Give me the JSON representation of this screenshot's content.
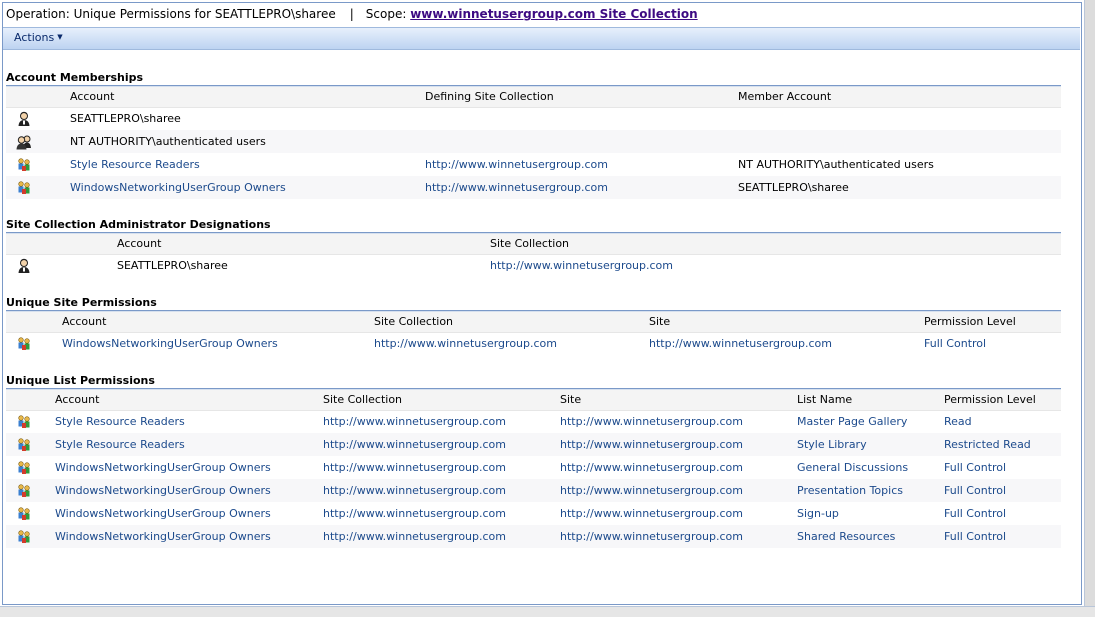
{
  "titlebar": {
    "operation": "Operation: Unique Permissions for SEATTLEPRO\\sharee",
    "separator": "|",
    "scope_label": "Scope:",
    "scope_link": "www.winnetusergroup.com Site Collection"
  },
  "toolbar": {
    "actions_label": "Actions"
  },
  "account_memberships": {
    "title": "Account Memberships",
    "headers": [
      "Account",
      "Defining Site Collection",
      "Member Account"
    ],
    "rows": [
      {
        "icon": "user-icon",
        "account": "SEATTLEPRO\\sharee",
        "site_collection": "",
        "member": ""
      },
      {
        "icon": "users-group-icon",
        "account": "NT AUTHORITY\\authenticated users",
        "site_collection": "",
        "member": ""
      },
      {
        "icon": "sharepoint-group-icon",
        "account": "Style Resource Readers",
        "site_collection": "http://www.winnetusergroup.com",
        "member": "NT AUTHORITY\\authenticated users"
      },
      {
        "icon": "sharepoint-group-icon",
        "account": "WindowsNetworkingUserGroup Owners",
        "site_collection": "http://www.winnetusergroup.com",
        "member": "SEATTLEPRO\\sharee"
      }
    ]
  },
  "admin_designations": {
    "title": "Site Collection Administrator Designations",
    "headers": [
      "Account",
      "Site Collection"
    ],
    "rows": [
      {
        "icon": "user-icon",
        "account": "SEATTLEPRO\\sharee",
        "site_collection": "http://www.winnetusergroup.com"
      }
    ]
  },
  "site_permissions": {
    "title": "Unique Site Permissions",
    "headers": [
      "Account",
      "Site Collection",
      "Site",
      "Permission Level"
    ],
    "rows": [
      {
        "icon": "sharepoint-group-icon",
        "account": "WindowsNetworkingUserGroup Owners",
        "site_collection": "http://www.winnetusergroup.com",
        "site": "http://www.winnetusergroup.com",
        "level": "Full Control"
      }
    ]
  },
  "list_permissions": {
    "title": "Unique List Permissions",
    "headers": [
      "Account",
      "Site Collection",
      "Site",
      "List Name",
      "Permission Level"
    ],
    "rows": [
      {
        "icon": "sharepoint-group-icon",
        "account": "Style Resource Readers",
        "site_collection": "http://www.winnetusergroup.com",
        "site": "http://www.winnetusergroup.com",
        "list": "Master Page Gallery",
        "level": "Read"
      },
      {
        "icon": "sharepoint-group-icon",
        "account": "Style Resource Readers",
        "site_collection": "http://www.winnetusergroup.com",
        "site": "http://www.winnetusergroup.com",
        "list": "Style Library",
        "level": "Restricted Read"
      },
      {
        "icon": "sharepoint-group-icon",
        "account": "WindowsNetworkingUserGroup Owners",
        "site_collection": "http://www.winnetusergroup.com",
        "site": "http://www.winnetusergroup.com",
        "list": "General Discussions",
        "level": "Full Control"
      },
      {
        "icon": "sharepoint-group-icon",
        "account": "WindowsNetworkingUserGroup Owners",
        "site_collection": "http://www.winnetusergroup.com",
        "site": "http://www.winnetusergroup.com",
        "list": "Presentation Topics",
        "level": "Full Control"
      },
      {
        "icon": "sharepoint-group-icon",
        "account": "WindowsNetworkingUserGroup Owners",
        "site_collection": "http://www.winnetusergroup.com",
        "site": "http://www.winnetusergroup.com",
        "list": "Sign-up",
        "level": "Full Control"
      },
      {
        "icon": "sharepoint-group-icon",
        "account": "WindowsNetworkingUserGroup Owners",
        "site_collection": "http://www.winnetusergroup.com",
        "site": "http://www.winnetusergroup.com",
        "list": "Shared Resources",
        "level": "Full Control"
      }
    ]
  },
  "colors": {
    "link": "#1c4a8c",
    "scope_link": "#3d0a82",
    "rule": "#7a99c8",
    "toolbar_top": "#e7f0fc",
    "toolbar_bottom": "#bdd3f1"
  }
}
